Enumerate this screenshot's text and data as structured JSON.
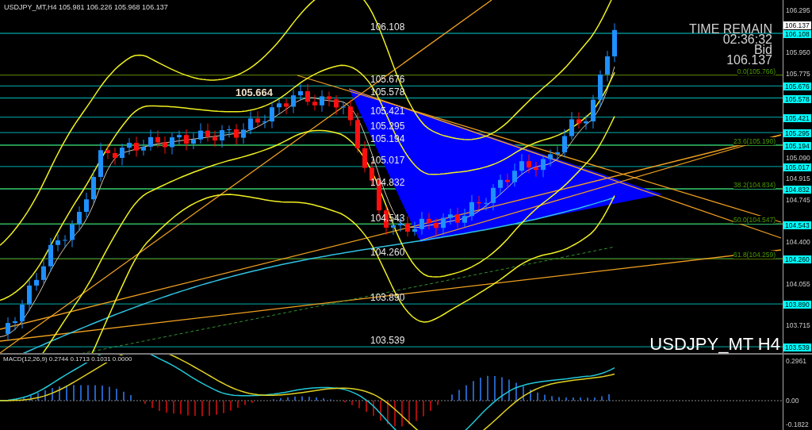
{
  "chart_header": {
    "title": "USDJPY_MT,H4  105.981 106.226 105.968 106.137"
  },
  "peak_label": "105.664",
  "levels": [
    {
      "label": "106.108",
      "tag": "106.108"
    },
    {
      "label": "105.676",
      "tag": "105.676"
    },
    {
      "label": "105.578",
      "tag": "105.578"
    },
    {
      "label": "105.421",
      "tag": "105.421"
    },
    {
      "label": "105.295",
      "tag": "105.295"
    },
    {
      "label": "105.194",
      "tag": "105.194"
    },
    {
      "label": "105.017",
      "tag": "105.017"
    },
    {
      "label": "104.832",
      "tag": "104.832"
    },
    {
      "label": "104.543",
      "tag": "104.543"
    },
    {
      "label": "104.260",
      "tag": "104.260"
    },
    {
      "label": "103.890",
      "tag": "103.890"
    },
    {
      "label": "103.539",
      "tag": "103.539"
    }
  ],
  "fib_levels": [
    {
      "label": "0.0(105.766)"
    },
    {
      "label": "23.6(105.190)"
    },
    {
      "label": "38.2(104.834)"
    },
    {
      "label": "50.0(104.547)"
    },
    {
      "label": "61.8(104.259)"
    }
  ],
  "price_axis": {
    "ticks": [
      "106.295",
      "105.950",
      "105.775",
      "105.090",
      "104.915",
      "104.745",
      "104.400",
      "104.055",
      "103.715"
    ],
    "bid_tag": "106.137"
  },
  "info": {
    "time_remain_label": "TIME REMAIN",
    "time_remain": "02:36:32",
    "bid_label": "Bid",
    "bid": "106.137"
  },
  "symbol_label": "USDJPY_MT H4",
  "macd": {
    "title": "MACD(12,26,9) 0.2744 0.1713 0.1031 0.0000",
    "ticks": [
      "0.2961",
      "0.00",
      "-0.1822"
    ]
  }
}
